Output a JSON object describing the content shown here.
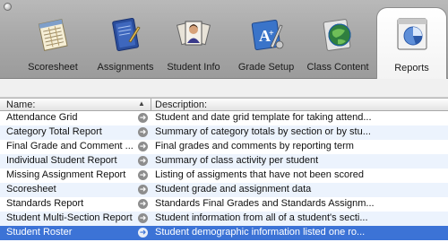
{
  "tabs": [
    {
      "label": "Scoresheet",
      "icon": "scoresheet-icon"
    },
    {
      "label": "Assignments",
      "icon": "assignments-icon"
    },
    {
      "label": "Student Info",
      "icon": "student-info-icon"
    },
    {
      "label": "Grade Setup",
      "icon": "grade-setup-icon"
    },
    {
      "label": "Class Content",
      "icon": "class-content-icon"
    },
    {
      "label": "Reports",
      "icon": "reports-icon",
      "active": true
    }
  ],
  "table": {
    "headers": {
      "name": "Name:",
      "description": "Description:"
    },
    "rows": [
      {
        "name": "Attendance Grid",
        "description": "Student and date grid template for taking attend..."
      },
      {
        "name": "Category Total Report",
        "description": "Summary of category totals by section or by stu..."
      },
      {
        "name": "Final Grade and Comment ...",
        "description": "Final grades and comments by reporting term"
      },
      {
        "name": "Individual Student Report",
        "description": "Summary of class activity per student"
      },
      {
        "name": "Missing Assignment Report",
        "description": "Listing of assigments that have not been scored"
      },
      {
        "name": "Scoresheet",
        "description": "Student grade and assignment data"
      },
      {
        "name": "Standards Report",
        "description": "Standards Final Grades and Standards Assignm..."
      },
      {
        "name": "Student Multi-Section Report",
        "description": "Student information from all of a student's secti..."
      },
      {
        "name": "Student Roster",
        "description": "Student demographic information listed one ro...",
        "selected": true
      }
    ]
  },
  "colors": {
    "selection": "#3c73d6",
    "alt_row": "#ecf3fd",
    "toolbar": "#a9a9a9"
  }
}
